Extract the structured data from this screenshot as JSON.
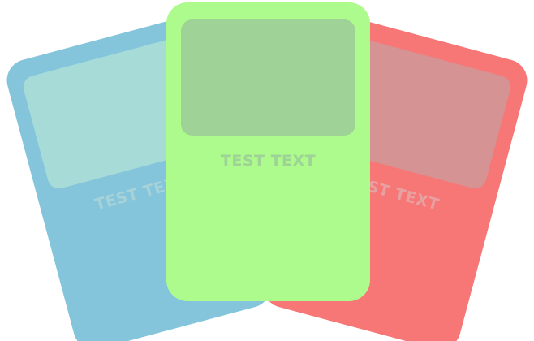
{
  "colors": {
    "blue_card": "#84c5dc",
    "blue_image": "#a7dbd8",
    "green_card": "#acfb8c",
    "green_image": "#9ed296",
    "red_card": "#f77676",
    "red_image": "#d69393"
  },
  "cards": {
    "left": {
      "text": "TEST TEXT"
    },
    "center": {
      "text": "TEST TEXT"
    },
    "right": {
      "text": "TEST TEXT"
    }
  }
}
